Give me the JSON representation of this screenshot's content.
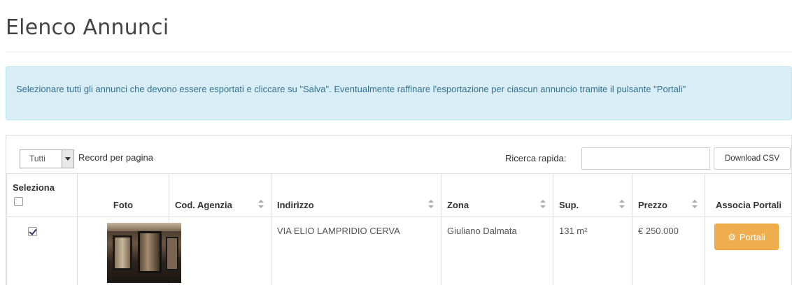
{
  "page": {
    "title": "Elenco Annunci"
  },
  "alert": {
    "text": "Selezionare tutti gli annunci che devono essere esportati e cliccare su \"Salva\". Eventualmente raffinare l'esportazione per ciascun annuncio tramite il pulsante \"Portali\"",
    "color": "#d9edf7"
  },
  "toolbar": {
    "page_size_value": "Tutti",
    "page_size_label": "Record per pagina",
    "search_label": "Ricerca rapida:",
    "search_value": "",
    "csv_button_label": "Download CSV"
  },
  "table": {
    "columns": [
      {
        "label": "Seleziona",
        "sortable": false
      },
      {
        "label": "Foto",
        "sortable": false
      },
      {
        "label": "Cod. Agenzia",
        "sortable": true
      },
      {
        "label": "Indirizzo",
        "sortable": true
      },
      {
        "label": "Zona",
        "sortable": true
      },
      {
        "label": "Sup.",
        "sortable": true
      },
      {
        "label": "Prezzo",
        "sortable": true
      },
      {
        "label": "Associa Portali",
        "sortable": false
      }
    ],
    "rows": [
      {
        "selected": true,
        "cod_agenzia": "",
        "indirizzo": "VIA ELIO LAMPRIDIO CERVA",
        "zona": "Giuliano Dalmata",
        "sup": "131 m²",
        "prezzo": "€ 250.000",
        "action_label": "Portali"
      }
    ]
  },
  "colors": {
    "warning_button": "#f0ad4e",
    "border": "#dddddd"
  },
  "icons": {
    "action": "cogs-icon",
    "sort": "sort-icon",
    "dropdown": "chevron-down-icon"
  }
}
